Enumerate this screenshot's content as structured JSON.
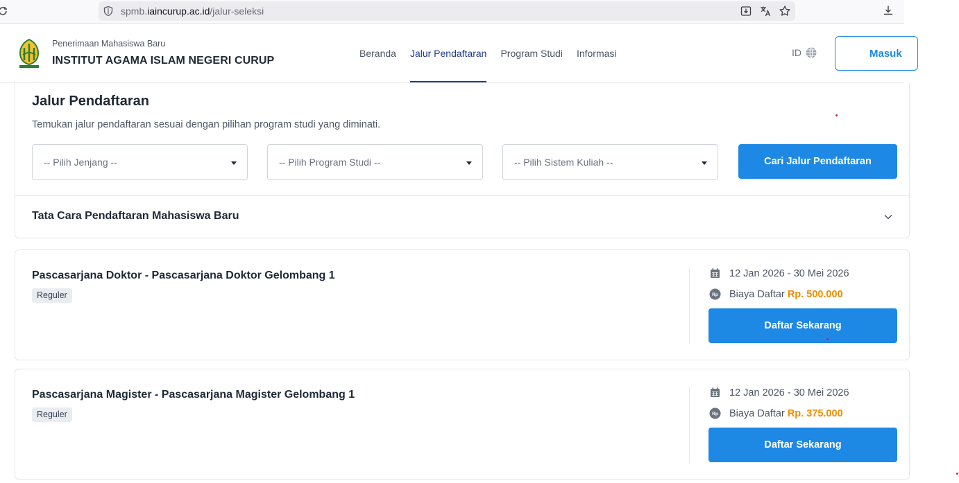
{
  "browser": {
    "url_prefix": "spmb.",
    "url_host": "iaincurup.ac.id",
    "url_path": "/jalur-seleksi"
  },
  "header": {
    "brand_sub": "Penerimaan Mahasiswa Baru",
    "brand_main": "INSTITUT AGAMA ISLAM NEGERI CURUP",
    "nav": [
      {
        "label": "Beranda",
        "active": false
      },
      {
        "label": "Jalur Pendaftaran",
        "active": true
      },
      {
        "label": "Program Studi",
        "active": false
      },
      {
        "label": "Informasi",
        "active": false
      }
    ],
    "lang": "ID",
    "login_label": "Masuk"
  },
  "search": {
    "title": "Jalur Pendaftaran",
    "subtitle": "Temukan jalur pendaftaran sesuai dengan pilihan program studi yang diminati.",
    "jenjang_placeholder": "-- Pilih Jenjang --",
    "prodi_placeholder": "-- Pilih Program Studi --",
    "sistem_placeholder": "-- Pilih Sistem Kuliah --",
    "button_label": "Cari Jalur Pendaftaran"
  },
  "accordion": {
    "title": "Tata Cara Pendaftaran Mahasiswa Baru"
  },
  "cards": [
    {
      "title": "Pascasarjana Doktor - Pascasarjana Doktor Gelombang 1",
      "badge": "Reguler",
      "date_range": "12 Jan 2026 - 30 Mei 2026",
      "fee_label": "Biaya Daftar",
      "fee_value": "Rp. 500.000",
      "button_label": "Daftar Sekarang"
    },
    {
      "title": "Pascasarjana Magister - Pascasarjana Magister Gelombang 1",
      "badge": "Reguler",
      "date_range": "12 Jan 2026 - 30 Mei 2026",
      "fee_label": "Biaya Daftar",
      "fee_value": "Rp. 375.000",
      "button_label": "Daftar Sekarang"
    }
  ],
  "colors": {
    "primary": "#1e88e5",
    "nav_active": "#1e3a8a",
    "price": "#f08c00"
  }
}
